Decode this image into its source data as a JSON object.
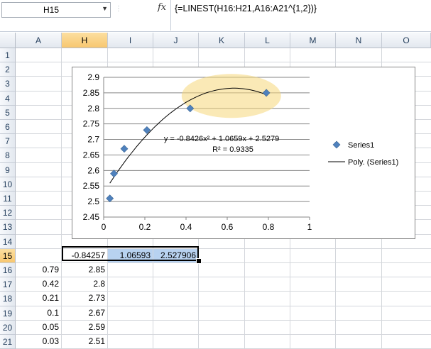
{
  "name_box": "H15",
  "fx_label": "fx",
  "formula": "{=LINEST(H16:H21,A16:A21^{1,2})}",
  "columns": [
    "A",
    "H",
    "I",
    "J",
    "K",
    "L",
    "M",
    "N",
    "O"
  ],
  "rows": [
    "1",
    "2",
    "3",
    "4",
    "5",
    "6",
    "7",
    "8",
    "9",
    "10",
    "11",
    "12",
    "13",
    "14",
    "15",
    "16",
    "17",
    "18",
    "19",
    "20",
    "21"
  ],
  "cells": {
    "r15": {
      "H": "-0.84257",
      "I": "1.06593",
      "J": "2.527906"
    },
    "r16": {
      "A": "0.79",
      "H": "2.85"
    },
    "r17": {
      "A": "0.42",
      "H": "2.8"
    },
    "r18": {
      "A": "0.21",
      "H": "2.73"
    },
    "r19": {
      "A": "0.1",
      "H": "2.67"
    },
    "r20": {
      "A": "0.05",
      "H": "2.59"
    },
    "r21": {
      "A": "0.03",
      "H": "2.51"
    }
  },
  "chart_data": {
    "type": "scatter",
    "series": [
      {
        "name": "Series1",
        "x": [
          0.79,
          0.42,
          0.21,
          0.1,
          0.05,
          0.03
        ],
        "y": [
          2.85,
          2.8,
          2.73,
          2.67,
          2.59,
          2.51
        ],
        "color": "#4f81bd"
      }
    ],
    "trendline": {
      "name": "Poly. (Series1)",
      "coefficients": [
        -0.8426,
        1.0659,
        2.5279
      ],
      "equation": "y = -0.8426x² + 1.0659x + 2.5279",
      "r_squared": "R² = 0.9335"
    },
    "xlim": [
      0,
      1
    ],
    "ylim": [
      2.45,
      2.9
    ],
    "x_ticks": [
      "0",
      "0.2",
      "0.4",
      "0.6",
      "0.8",
      "1"
    ],
    "y_ticks": [
      "2.45",
      "2.5",
      "2.55",
      "2.6",
      "2.65",
      "2.7",
      "2.75",
      "2.8",
      "2.85",
      "2.9"
    ],
    "grid": true,
    "legend_position": "right",
    "highlight_color": "#f5d77a"
  }
}
